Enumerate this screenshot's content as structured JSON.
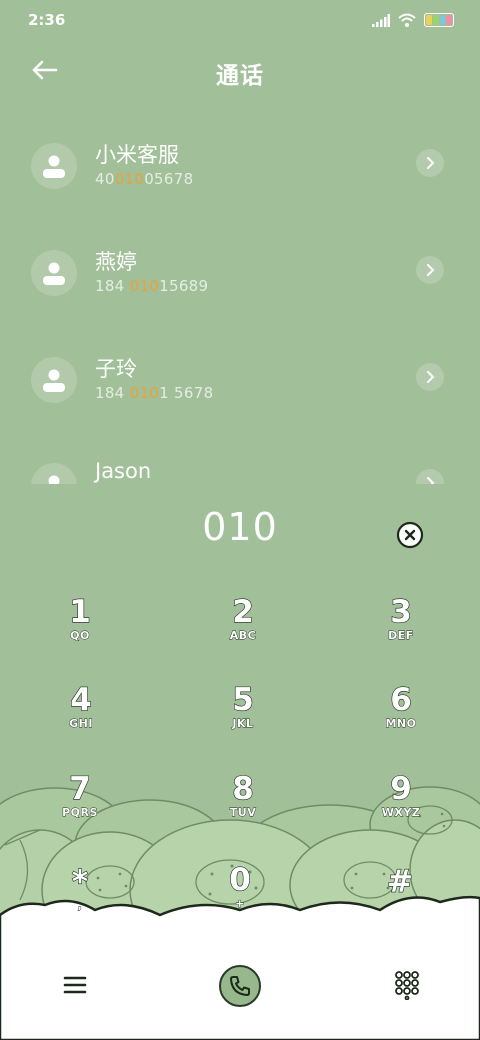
{
  "status_bar": {
    "time": "2:36",
    "icons": [
      "signal-icon",
      "wifi-icon",
      "battery-icon"
    ]
  },
  "header": {
    "back_icon": "back-arrow-icon",
    "title": "通话"
  },
  "results": [
    {
      "name": "小米客服",
      "number_pre": "40",
      "number_match": "010",
      "number_post": "05678"
    },
    {
      "name": "燕婷",
      "number_pre": "184 ",
      "number_match": "010",
      "number_post": "15689"
    },
    {
      "name": "子玲",
      "number_pre": "184 ",
      "number_match": "010",
      "number_post": "1 5678"
    },
    {
      "name": "Jason",
      "number_pre": "",
      "number_match": "",
      "number_post": ""
    }
  ],
  "dialer": {
    "typed_number": "010"
  },
  "keypad": [
    {
      "digit": "1",
      "letters": "QO"
    },
    {
      "digit": "2",
      "letters": "ABC"
    },
    {
      "digit": "3",
      "letters": "DEF"
    },
    {
      "digit": "4",
      "letters": "GHI"
    },
    {
      "digit": "5",
      "letters": "JKL"
    },
    {
      "digit": "6",
      "letters": "MNO"
    },
    {
      "digit": "7",
      "letters": "PQRS"
    },
    {
      "digit": "8",
      "letters": "TUV"
    },
    {
      "digit": "9",
      "letters": "WXYZ"
    },
    {
      "digit": "*",
      "letters": ","
    },
    {
      "digit": "0",
      "letters": "+"
    },
    {
      "digit": "#",
      "letters": ""
    }
  ],
  "bottom_bar": {
    "menu_icon": "menu-icon",
    "call_icon": "phone-icon",
    "keypad_icon": "dialpad-icon"
  },
  "colors": {
    "background": "#a1bf98",
    "match_highlight": "#e8a33a",
    "text": "#ffffff"
  }
}
